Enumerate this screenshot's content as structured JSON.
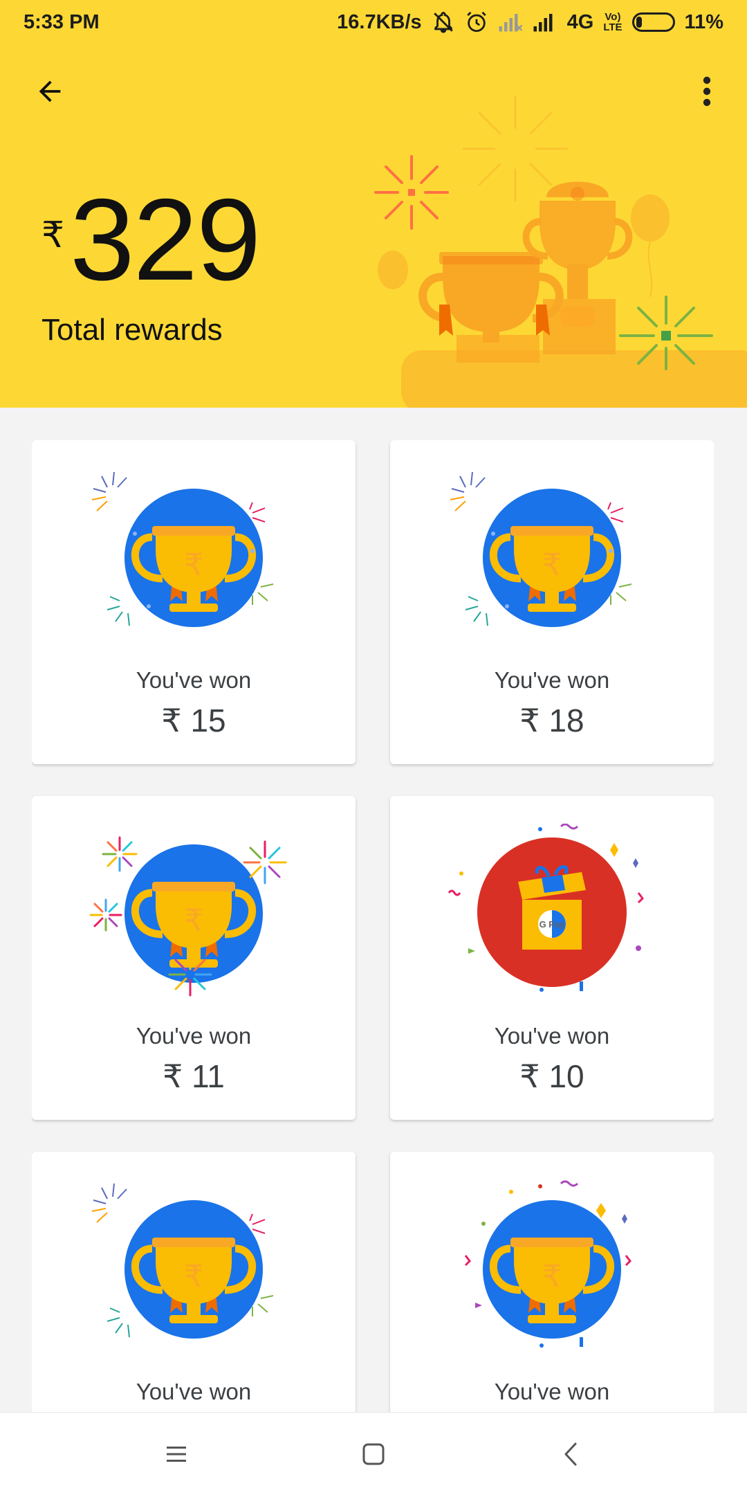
{
  "status_bar": {
    "time": "5:33 PM",
    "speed": "16.7KB/s",
    "network": "4G",
    "volte_top": "Vo)",
    "volte_bottom": "LTE",
    "battery": "11%"
  },
  "header": {
    "back_icon": "arrow-back-icon",
    "more_icon": "more-vert-icon",
    "currency_symbol": "₹",
    "total_amount": "329",
    "total_label": "Total rewards",
    "background_color": "#fdd835"
  },
  "rewards": [
    {
      "label": "You've won",
      "amount": "₹ 15",
      "art": "trophy",
      "circle_color": "#1a73e8"
    },
    {
      "label": "You've won",
      "amount": "₹ 18",
      "art": "trophy",
      "circle_color": "#1a73e8"
    },
    {
      "label": "You've won",
      "amount": "₹ 11",
      "art": "trophy",
      "circle_color": "#1a73e8"
    },
    {
      "label": "You've won",
      "amount": "₹ 10",
      "art": "gift-box",
      "circle_color": "#d93025"
    },
    {
      "label": "You've won",
      "amount": "",
      "art": "trophy",
      "circle_color": "#1a73e8"
    },
    {
      "label": "You've won",
      "amount": "",
      "art": "trophy",
      "circle_color": "#1a73e8"
    }
  ],
  "gift_logo_text": "G Pay",
  "nav_bar": {
    "menu_icon": "menu-icon",
    "home_icon": "home-square-icon",
    "back_icon": "nav-back-icon"
  }
}
